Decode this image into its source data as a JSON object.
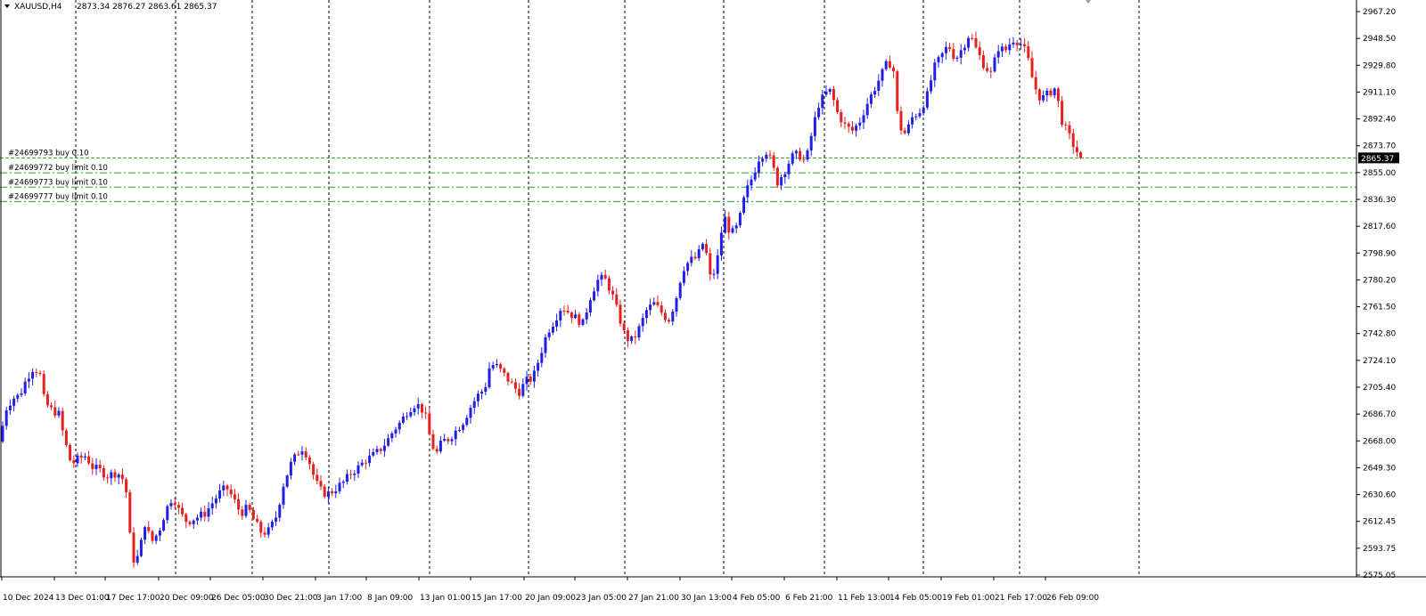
{
  "header": {
    "symbol": "XAUUSD,H4",
    "ohlc": "2873.34 2876.27 2863.61 2865.37"
  },
  "colors": {
    "bull": "#1f1fe6",
    "bear": "#e61f1f",
    "grid": "#000000",
    "orders": "#2e9e2e",
    "price_badge_bg": "#000000",
    "price_badge_fg": "#ffffff"
  },
  "chart_data": {
    "type": "candlestick",
    "symbol": "XAUUSD",
    "timeframe": "H4",
    "grid": "vertical dotted",
    "ylim": [
      2575.05,
      2967.2
    ],
    "y_ticks": [
      "2967.20",
      "2948.50",
      "2929.80",
      "2911.10",
      "2892.40",
      "2873.70",
      "2855.00",
      "2836.30",
      "2817.60",
      "2798.90",
      "2780.20",
      "2761.50",
      "2742.80",
      "2724.10",
      "2705.40",
      "2686.70",
      "2668.00",
      "2649.30",
      "2630.60",
      "2612.45",
      "2593.75",
      "2575.05"
    ],
    "x_ticks": [
      "10 Dec 2024",
      "13 Dec 01:00",
      "17 Dec 17:00",
      "20 Dec 09:00",
      "26 Dec 05:00",
      "30 Dec 21:00",
      "3 Jan 17:00",
      "8 Jan 09:00",
      "13 Jan 01:00",
      "15 Jan 17:00",
      "20 Jan 09:00",
      "23 Jan 05:00",
      "27 Jan 21:00",
      "30 Jan 13:00",
      "4 Feb 05:00",
      "6 Feb 21:00",
      "11 Feb 13:00",
      "14 Feb 05:00",
      "19 Feb 01:00",
      "21 Feb 17:00",
      "26 Feb 09:00"
    ],
    "current_price": "2865.37",
    "orders": [
      {
        "label": "#24699793 buy 0.10",
        "price": 2865.37
      },
      {
        "label": "#24699772 buy limit 0.10",
        "price": 2855.0
      },
      {
        "label": "#24699773 buy limit 0.10",
        "price": 2845.0
      },
      {
        "label": "#24699777 buy limit 0.10",
        "price": 2835.0
      }
    ],
    "price_path": [
      [
        0,
        2668
      ],
      [
        6,
        2690
      ],
      [
        14,
        2698
      ],
      [
        22,
        2700
      ],
      [
        30,
        2712
      ],
      [
        38,
        2720
      ],
      [
        45,
        2714
      ],
      [
        50,
        2695
      ],
      [
        58,
        2690
      ],
      [
        66,
        2687
      ],
      [
        72,
        2670
      ],
      [
        80,
        2652
      ],
      [
        88,
        2656
      ],
      [
        96,
        2658
      ],
      [
        104,
        2650
      ],
      [
        112,
        2648
      ],
      [
        120,
        2644
      ],
      [
        128,
        2646
      ],
      [
        136,
        2645
      ],
      [
        142,
        2632
      ],
      [
        148,
        2585
      ],
      [
        156,
        2588
      ],
      [
        162,
        2612
      ],
      [
        170,
        2598
      ],
      [
        178,
        2605
      ],
      [
        186,
        2620
      ],
      [
        194,
        2630
      ],
      [
        202,
        2618
      ],
      [
        210,
        2612
      ],
      [
        220,
        2615
      ],
      [
        230,
        2618
      ],
      [
        238,
        2625
      ],
      [
        246,
        2632
      ],
      [
        254,
        2636
      ],
      [
        262,
        2628
      ],
      [
        270,
        2618
      ],
      [
        278,
        2622
      ],
      [
        286,
        2612
      ],
      [
        294,
        2604
      ],
      [
        302,
        2606
      ],
      [
        310,
        2616
      ],
      [
        318,
        2638
      ],
      [
        326,
        2652
      ],
      [
        334,
        2660
      ],
      [
        340,
        2664
      ],
      [
        346,
        2656
      ],
      [
        354,
        2640
      ],
      [
        362,
        2632
      ],
      [
        370,
        2632
      ],
      [
        378,
        2636
      ],
      [
        386,
        2640
      ],
      [
        394,
        2646
      ],
      [
        402,
        2650
      ],
      [
        410,
        2655
      ],
      [
        418,
        2658
      ],
      [
        426,
        2662
      ],
      [
        434,
        2668
      ],
      [
        442,
        2676
      ],
      [
        450,
        2682
      ],
      [
        458,
        2690
      ],
      [
        466,
        2694
      ],
      [
        472,
        2692
      ],
      [
        478,
        2684
      ],
      [
        484,
        2666
      ],
      [
        490,
        2660
      ],
      [
        496,
        2668
      ],
      [
        504,
        2670
      ],
      [
        512,
        2676
      ],
      [
        520,
        2682
      ],
      [
        528,
        2692
      ],
      [
        536,
        2700
      ],
      [
        544,
        2705
      ],
      [
        550,
        2722
      ],
      [
        558,
        2720
      ],
      [
        566,
        2714
      ],
      [
        574,
        2708
      ],
      [
        582,
        2702
      ],
      [
        590,
        2710
      ],
      [
        598,
        2712
      ],
      [
        606,
        2728
      ],
      [
        614,
        2744
      ],
      [
        622,
        2752
      ],
      [
        630,
        2762
      ],
      [
        638,
        2758
      ],
      [
        646,
        2754
      ],
      [
        654,
        2750
      ],
      [
        662,
        2768
      ],
      [
        670,
        2780
      ],
      [
        678,
        2782
      ],
      [
        686,
        2772
      ],
      [
        694,
        2756
      ],
      [
        702,
        2740
      ],
      [
        710,
        2738
      ],
      [
        718,
        2748
      ],
      [
        726,
        2760
      ],
      [
        734,
        2764
      ],
      [
        742,
        2758
      ],
      [
        750,
        2752
      ],
      [
        758,
        2766
      ],
      [
        766,
        2788
      ],
      [
        774,
        2794
      ],
      [
        782,
        2796
      ],
      [
        790,
        2808
      ],
      [
        798,
        2778
      ],
      [
        806,
        2798
      ],
      [
        812,
        2826
      ],
      [
        820,
        2812
      ],
      [
        828,
        2818
      ],
      [
        836,
        2840
      ],
      [
        844,
        2852
      ],
      [
        852,
        2866
      ],
      [
        860,
        2870
      ],
      [
        866,
        2862
      ],
      [
        872,
        2848
      ],
      [
        880,
        2856
      ],
      [
        888,
        2866
      ],
      [
        896,
        2868
      ],
      [
        904,
        2862
      ],
      [
        910,
        2880
      ],
      [
        918,
        2902
      ],
      [
        926,
        2910
      ],
      [
        932,
        2912
      ],
      [
        940,
        2896
      ],
      [
        948,
        2888
      ],
      [
        956,
        2884
      ],
      [
        964,
        2890
      ],
      [
        972,
        2902
      ],
      [
        980,
        2912
      ],
      [
        988,
        2922
      ],
      [
        996,
        2932
      ],
      [
        1002,
        2930
      ],
      [
        1008,
        2888
      ],
      [
        1016,
        2882
      ],
      [
        1024,
        2894
      ],
      [
        1032,
        2898
      ],
      [
        1040,
        2908
      ],
      [
        1048,
        2928
      ],
      [
        1056,
        2936
      ],
      [
        1064,
        2944
      ],
      [
        1072,
        2934
      ],
      [
        1080,
        2942
      ],
      [
        1088,
        2952
      ],
      [
        1096,
        2940
      ],
      [
        1104,
        2930
      ],
      [
        1112,
        2924
      ],
      [
        1120,
        2942
      ],
      [
        1128,
        2940
      ],
      [
        1136,
        2948
      ],
      [
        1144,
        2946
      ],
      [
        1152,
        2938
      ],
      [
        1160,
        2916
      ],
      [
        1168,
        2906
      ],
      [
        1176,
        2910
      ],
      [
        1184,
        2914
      ],
      [
        1192,
        2890
      ],
      [
        1200,
        2880
      ],
      [
        1206,
        2872
      ],
      [
        1213,
        2865.37
      ]
    ]
  }
}
